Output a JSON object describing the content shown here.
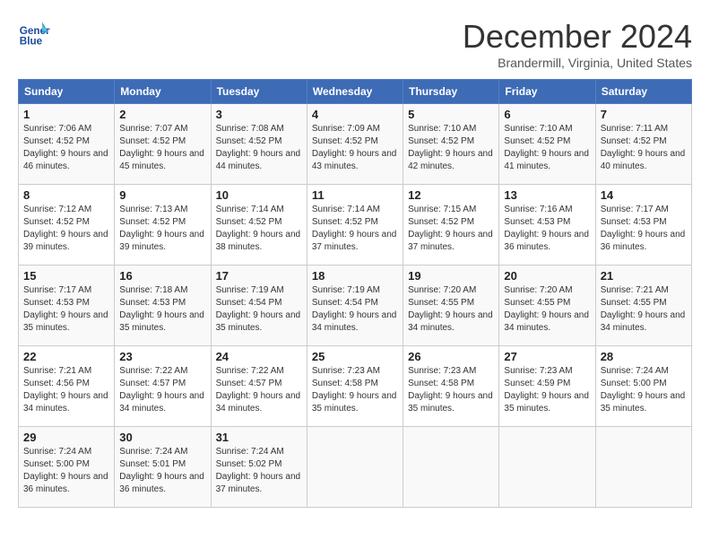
{
  "header": {
    "logo_line1": "General",
    "logo_line2": "Blue",
    "month": "December 2024",
    "location": "Brandermill, Virginia, United States"
  },
  "weekdays": [
    "Sunday",
    "Monday",
    "Tuesday",
    "Wednesday",
    "Thursday",
    "Friday",
    "Saturday"
  ],
  "weeks": [
    [
      {
        "day": "1",
        "sunrise": "7:06 AM",
        "sunset": "4:52 PM",
        "daylight": "9 hours and 46 minutes."
      },
      {
        "day": "2",
        "sunrise": "7:07 AM",
        "sunset": "4:52 PM",
        "daylight": "9 hours and 45 minutes."
      },
      {
        "day": "3",
        "sunrise": "7:08 AM",
        "sunset": "4:52 PM",
        "daylight": "9 hours and 44 minutes."
      },
      {
        "day": "4",
        "sunrise": "7:09 AM",
        "sunset": "4:52 PM",
        "daylight": "9 hours and 43 minutes."
      },
      {
        "day": "5",
        "sunrise": "7:10 AM",
        "sunset": "4:52 PM",
        "daylight": "9 hours and 42 minutes."
      },
      {
        "day": "6",
        "sunrise": "7:10 AM",
        "sunset": "4:52 PM",
        "daylight": "9 hours and 41 minutes."
      },
      {
        "day": "7",
        "sunrise": "7:11 AM",
        "sunset": "4:52 PM",
        "daylight": "9 hours and 40 minutes."
      }
    ],
    [
      {
        "day": "8",
        "sunrise": "7:12 AM",
        "sunset": "4:52 PM",
        "daylight": "9 hours and 39 minutes."
      },
      {
        "day": "9",
        "sunrise": "7:13 AM",
        "sunset": "4:52 PM",
        "daylight": "9 hours and 39 minutes."
      },
      {
        "day": "10",
        "sunrise": "7:14 AM",
        "sunset": "4:52 PM",
        "daylight": "9 hours and 38 minutes."
      },
      {
        "day": "11",
        "sunrise": "7:14 AM",
        "sunset": "4:52 PM",
        "daylight": "9 hours and 37 minutes."
      },
      {
        "day": "12",
        "sunrise": "7:15 AM",
        "sunset": "4:52 PM",
        "daylight": "9 hours and 37 minutes."
      },
      {
        "day": "13",
        "sunrise": "7:16 AM",
        "sunset": "4:53 PM",
        "daylight": "9 hours and 36 minutes."
      },
      {
        "day": "14",
        "sunrise": "7:17 AM",
        "sunset": "4:53 PM",
        "daylight": "9 hours and 36 minutes."
      }
    ],
    [
      {
        "day": "15",
        "sunrise": "7:17 AM",
        "sunset": "4:53 PM",
        "daylight": "9 hours and 35 minutes."
      },
      {
        "day": "16",
        "sunrise": "7:18 AM",
        "sunset": "4:53 PM",
        "daylight": "9 hours and 35 minutes."
      },
      {
        "day": "17",
        "sunrise": "7:19 AM",
        "sunset": "4:54 PM",
        "daylight": "9 hours and 35 minutes."
      },
      {
        "day": "18",
        "sunrise": "7:19 AM",
        "sunset": "4:54 PM",
        "daylight": "9 hours and 34 minutes."
      },
      {
        "day": "19",
        "sunrise": "7:20 AM",
        "sunset": "4:55 PM",
        "daylight": "9 hours and 34 minutes."
      },
      {
        "day": "20",
        "sunrise": "7:20 AM",
        "sunset": "4:55 PM",
        "daylight": "9 hours and 34 minutes."
      },
      {
        "day": "21",
        "sunrise": "7:21 AM",
        "sunset": "4:55 PM",
        "daylight": "9 hours and 34 minutes."
      }
    ],
    [
      {
        "day": "22",
        "sunrise": "7:21 AM",
        "sunset": "4:56 PM",
        "daylight": "9 hours and 34 minutes."
      },
      {
        "day": "23",
        "sunrise": "7:22 AM",
        "sunset": "4:57 PM",
        "daylight": "9 hours and 34 minutes."
      },
      {
        "day": "24",
        "sunrise": "7:22 AM",
        "sunset": "4:57 PM",
        "daylight": "9 hours and 34 minutes."
      },
      {
        "day": "25",
        "sunrise": "7:23 AM",
        "sunset": "4:58 PM",
        "daylight": "9 hours and 35 minutes."
      },
      {
        "day": "26",
        "sunrise": "7:23 AM",
        "sunset": "4:58 PM",
        "daylight": "9 hours and 35 minutes."
      },
      {
        "day": "27",
        "sunrise": "7:23 AM",
        "sunset": "4:59 PM",
        "daylight": "9 hours and 35 minutes."
      },
      {
        "day": "28",
        "sunrise": "7:24 AM",
        "sunset": "5:00 PM",
        "daylight": "9 hours and 35 minutes."
      }
    ],
    [
      {
        "day": "29",
        "sunrise": "7:24 AM",
        "sunset": "5:00 PM",
        "daylight": "9 hours and 36 minutes."
      },
      {
        "day": "30",
        "sunrise": "7:24 AM",
        "sunset": "5:01 PM",
        "daylight": "9 hours and 36 minutes."
      },
      {
        "day": "31",
        "sunrise": "7:24 AM",
        "sunset": "5:02 PM",
        "daylight": "9 hours and 37 minutes."
      },
      null,
      null,
      null,
      null
    ]
  ],
  "labels": {
    "sunrise_prefix": "Sunrise: ",
    "sunset_prefix": "Sunset: ",
    "daylight_prefix": "Daylight: "
  }
}
